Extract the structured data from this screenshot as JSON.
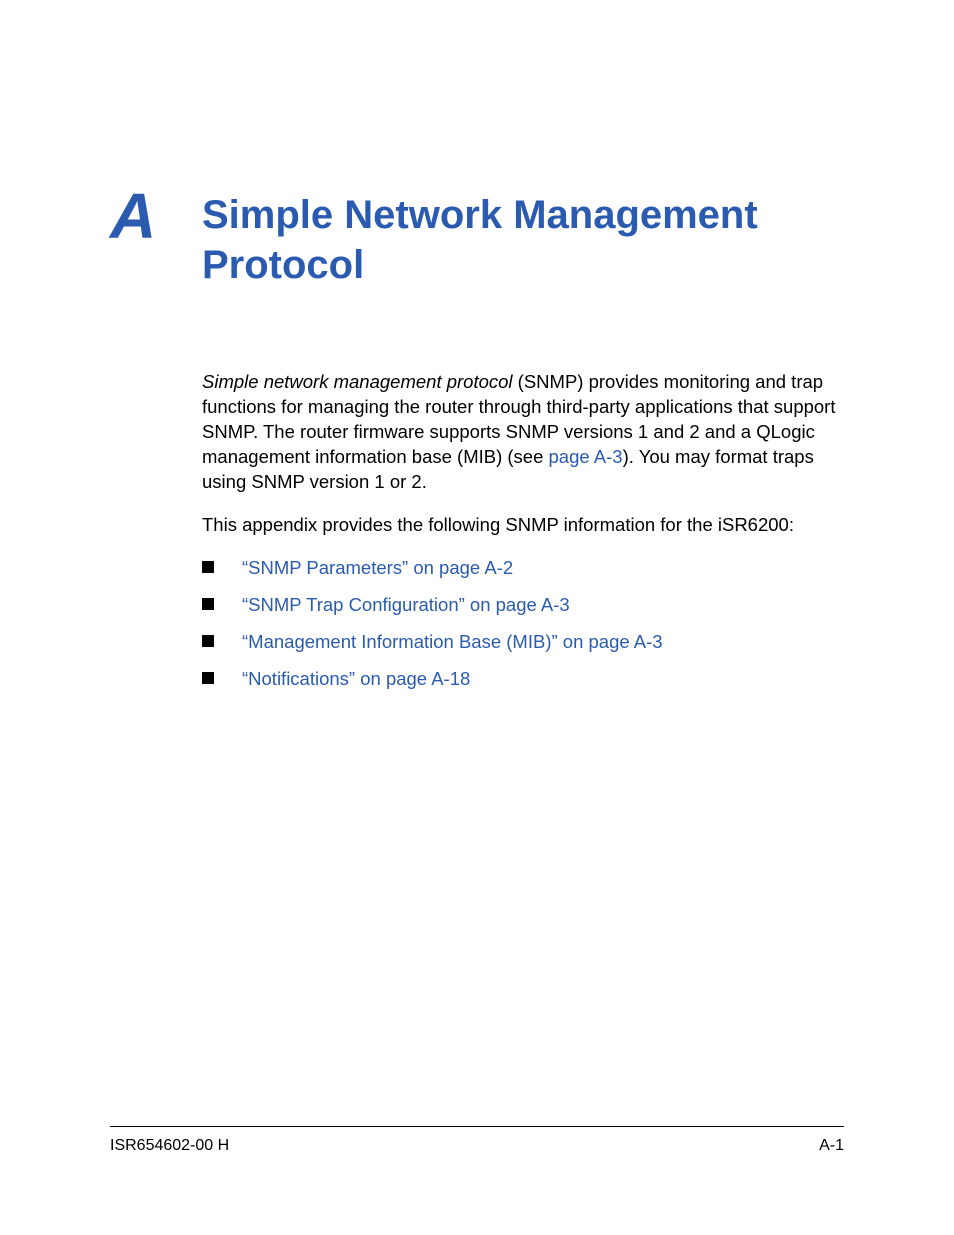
{
  "heading": {
    "letter": "A",
    "title": "Simple Network Management Protocol"
  },
  "paragraph1": {
    "italic_lead": "Simple network management protocol",
    "after_italic": " (SNMP) provides monitoring and trap functions for managing the router through third-party applications that support SNMP. The router firmware supports SNMP versions 1 and 2 and a QLogic management information base (MIB) (see ",
    "inline_link": "page A-3",
    "after_link": "). You may format traps using SNMP version 1 or 2."
  },
  "paragraph2": "This appendix provides the following SNMP information for the iSR6200:",
  "bullets": [
    "“SNMP Parameters” on page A-2",
    "“SNMP Trap Configuration” on page A-3",
    "“Management Information Base (MIB)” on page A-3",
    "“Notifications” on page A-18"
  ],
  "footer": {
    "left": "ISR654602-00  H",
    "right": "A-1"
  }
}
